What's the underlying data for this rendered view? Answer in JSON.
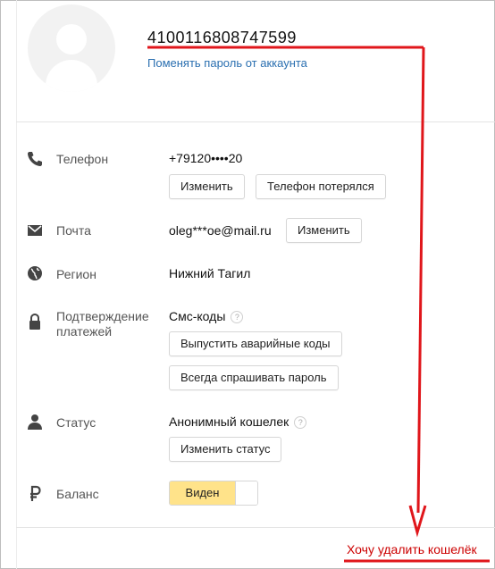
{
  "account": {
    "number": "4100116808747599",
    "change_password_link": "Поменять пароль от аккаунта"
  },
  "phone": {
    "label": "Телефон",
    "value": "+79120••••20",
    "change_button": "Изменить",
    "lost_button": "Телефон потерялся",
    "icon": "phone-icon"
  },
  "email": {
    "label": "Почта",
    "value": "oleg***oe@mail.ru",
    "change_button": "Изменить",
    "icon": "mail-icon"
  },
  "region": {
    "label": "Регион",
    "value": "Нижний Тагил",
    "icon": "globe-icon"
  },
  "payments": {
    "label": "Подтверждение платежей",
    "value": "Смс-коды",
    "help": "?",
    "emergency_codes_button": "Выпустить аварийные коды",
    "always_ask_button": "Всегда спрашивать пароль",
    "icon": "lock-icon"
  },
  "status": {
    "label": "Статус",
    "value": "Анонимный кошелек",
    "help": "?",
    "change_button": "Изменить статус",
    "icon": "user-icon"
  },
  "balance": {
    "label": "Баланс",
    "toggle_label": "Виден",
    "toggle_on": true,
    "icon": "ruble-icon"
  },
  "delete_wallet_link": "Хочу удалить кошелёк",
  "colors": {
    "link": "#2a6fb0",
    "annotation": "#e0161b",
    "toggle_on": "#ffe38a",
    "delete_link": "#cc0000"
  }
}
